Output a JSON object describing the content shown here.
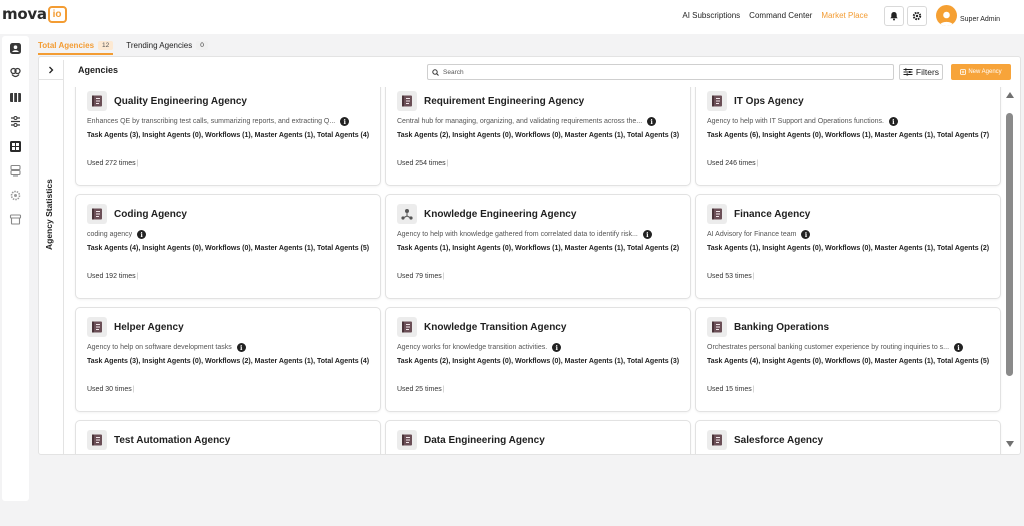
{
  "app": {
    "logo_text": "mova",
    "logo_badge": "io",
    "brand_color": "#f39c33"
  },
  "header": {
    "nav": [
      {
        "label": "AI Subscriptions",
        "active": false
      },
      {
        "label": "Command Center",
        "active": false
      },
      {
        "label": "Market Place",
        "active": true
      }
    ],
    "user_name": "Super Admin"
  },
  "tabs": [
    {
      "label": "Total Agencies",
      "count": "12",
      "active": true
    },
    {
      "label": "Trending Agencies",
      "count": "0",
      "active": false
    }
  ],
  "stats_panel": {
    "label": "Agency Statistics"
  },
  "agencies": {
    "title": "Agencies",
    "search_placeholder": "Search",
    "filters_label": "Filters",
    "new_label": "New Agency"
  },
  "cards": [
    {
      "title": "Quality Engineering Agency",
      "description": "Enhances QE by transcribing test calls, summarizing reports, and extracting Q...",
      "agents": "Task Agents (3), Insight Agents (0), Workflows (1), Master Agents (1), Total Agents (4)",
      "used": "Used 272 times",
      "icon": "book-icon"
    },
    {
      "title": "Requirement Engineering Agency",
      "description": "Central hub for managing, organizing, and validating requirements across the...",
      "agents": "Task Agents (2), Insight Agents (0), Workflows (0), Master Agents (1), Total Agents (3)",
      "used": "Used 254 times",
      "icon": "book-icon"
    },
    {
      "title": "IT Ops Agency",
      "description": "Agency to help with IT Support and Operations functions.",
      "agents": "Task Agents (6), Insight Agents (0), Workflows (1), Master Agents (1), Total Agents (7)",
      "used": "Used 246 times",
      "icon": "book-icon"
    },
    {
      "title": "Coding Agency",
      "description": "coding agency",
      "agents": "Task Agents (4), Insight Agents (0), Workflows (0), Master Agents (1), Total Agents (5)",
      "used": "Used 192 times",
      "icon": "book-icon"
    },
    {
      "title": "Knowledge Engineering Agency",
      "description": "Agency to help with knowledge gathered from correlated data to identify risk...",
      "agents": "Task Agents (1), Insight Agents (0), Workflows (1), Master Agents (1), Total Agents (2)",
      "used": "Used 79 times",
      "icon": "network-icon"
    },
    {
      "title": "Finance Agency",
      "description": "AI Advisory for Finance team",
      "agents": "Task Agents (1), Insight Agents (0), Workflows (0), Master Agents (1), Total Agents (2)",
      "used": "Used 53 times",
      "icon": "book-icon"
    },
    {
      "title": "Helper Agency",
      "description": "Agency to help on software development tasks",
      "agents": "Task Agents (3), Insight Agents (0), Workflows (2), Master Agents (1), Total Agents (4)",
      "used": "Used 30 times",
      "icon": "book-icon"
    },
    {
      "title": "Knowledge Transition Agency",
      "description": "Agency works for knowledge transition activities.",
      "agents": "Task Agents (2), Insight Agents (0), Workflows (0), Master Agents (1), Total Agents (3)",
      "used": "Used 25 times",
      "icon": "book-icon"
    },
    {
      "title": "Banking Operations",
      "description": "Orchestrates personal banking customer experience by routing inquiries to s...",
      "agents": "Task Agents (4), Insight Agents (0), Workflows (0), Master Agents (1), Total Agents (5)",
      "used": "Used 15 times",
      "icon": "book-icon"
    },
    {
      "title": "Test Automation Agency",
      "description": "",
      "agents": "",
      "used": "",
      "icon": "book-icon"
    },
    {
      "title": "Data Engineering Agency",
      "description": "",
      "agents": "",
      "used": "",
      "icon": "book-icon"
    },
    {
      "title": "Salesforce Agency",
      "description": "",
      "agents": "",
      "used": "",
      "icon": "book-icon"
    }
  ],
  "rail_icons": [
    "user-badge-icon",
    "brain-icon",
    "book-stack-icon",
    "flow-icon",
    "dashboard-icon",
    "server-icon",
    "gear-chip-icon",
    "archive-icon"
  ]
}
